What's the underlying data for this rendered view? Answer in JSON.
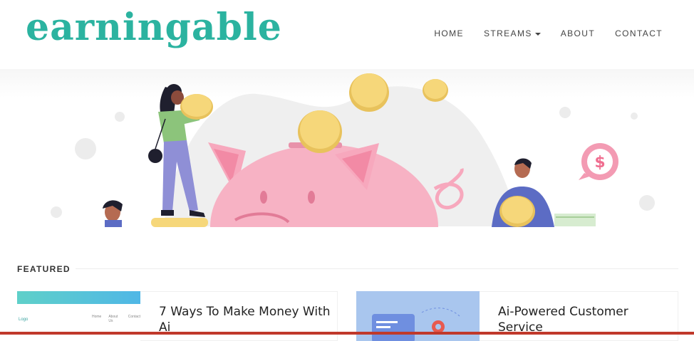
{
  "header": {
    "logo": "earningable",
    "nav": [
      {
        "label": "HOME"
      },
      {
        "label": "STREAMS"
      },
      {
        "label": "ABOUT"
      },
      {
        "label": "CONTACT"
      }
    ]
  },
  "sections": {
    "featured_label": "FEATURED"
  },
  "cards": [
    {
      "title_line1": "7 Ways To Make Money With",
      "title_line2": "Ai",
      "thumb": {
        "logo_text": "Logo",
        "nav": [
          "Home",
          "About Us",
          "Contact"
        ]
      }
    },
    {
      "title_line1": "Ai-Powered Customer",
      "title_line2": "Service"
    }
  ],
  "colors": {
    "brand": "#2bb3a0",
    "pig": "#f7b2c4",
    "coin": "#f6d77a",
    "accent_bar": "#c0392b"
  }
}
